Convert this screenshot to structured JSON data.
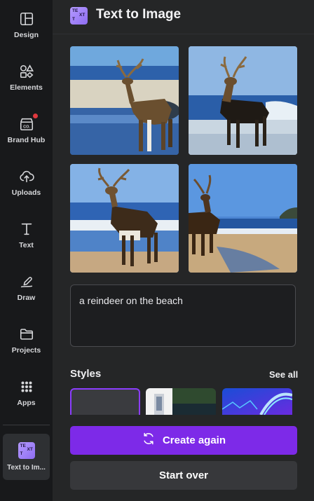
{
  "sidebar": {
    "items": [
      {
        "label": "Design",
        "icon": "layout-icon"
      },
      {
        "label": "Elements",
        "icon": "shapes-icon"
      },
      {
        "label": "Brand Hub",
        "icon": "brand-hub-icon",
        "notification": true
      },
      {
        "label": "Uploads",
        "icon": "cloud-upload-icon"
      },
      {
        "label": "Text",
        "icon": "text-t-icon"
      },
      {
        "label": "Draw",
        "icon": "draw-pen-icon"
      },
      {
        "label": "Projects",
        "icon": "folder-icon"
      },
      {
        "label": "Apps",
        "icon": "apps-grid-icon"
      }
    ],
    "active_app": {
      "label": "Text to Im...",
      "icon": "text-to-image-app-icon"
    }
  },
  "header": {
    "title": "Text to Image"
  },
  "results": {
    "images": [
      {
        "description": "reindeer-on-beach-1"
      },
      {
        "description": "reindeer-on-beach-2"
      },
      {
        "description": "reindeer-on-beach-3"
      },
      {
        "description": "reindeer-on-beach-4"
      }
    ]
  },
  "prompt": {
    "value": "a reindeer on the beach"
  },
  "styles": {
    "heading": "Styles",
    "see_all_label": "See all",
    "options": [
      {
        "name": "none-style",
        "selected": true
      },
      {
        "name": "photo-style",
        "selected": false
      },
      {
        "name": "neon-style",
        "selected": false
      }
    ]
  },
  "actions": {
    "create_again_label": "Create again",
    "start_over_label": "Start over"
  },
  "colors": {
    "accent": "#7d2ae8",
    "sidebar_bg": "#18191b",
    "panel_bg": "#252627",
    "notification": "#e0383e"
  }
}
